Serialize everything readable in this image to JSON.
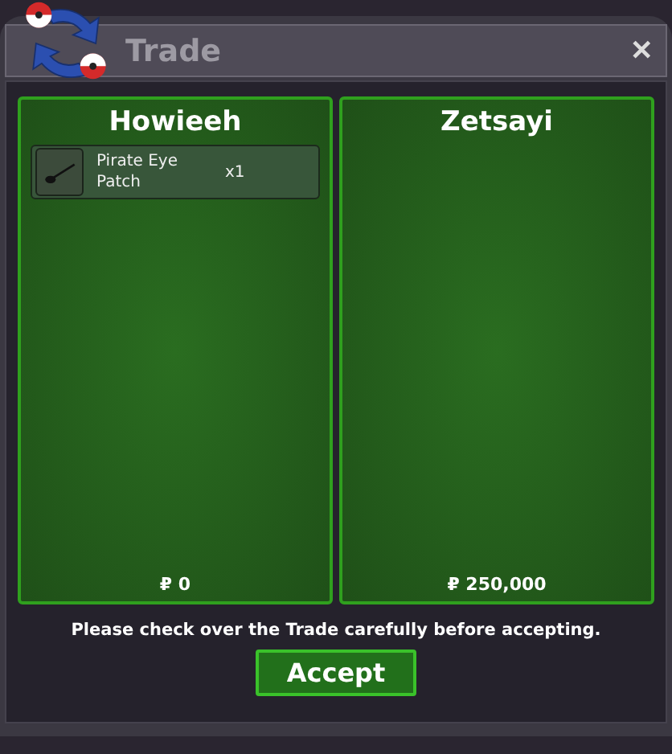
{
  "window": {
    "title": "Trade",
    "close": "✕"
  },
  "panels": [
    {
      "name": "Howieeh",
      "items": [
        {
          "name": "Pirate Eye Patch",
          "quantity": "x1"
        }
      ],
      "money": "₽ 0"
    },
    {
      "name": "Zetsayi",
      "money": "₽ 250,000"
    }
  ],
  "notice": "Please check over the Trade carefully before accepting.",
  "accept_button": "Accept"
}
